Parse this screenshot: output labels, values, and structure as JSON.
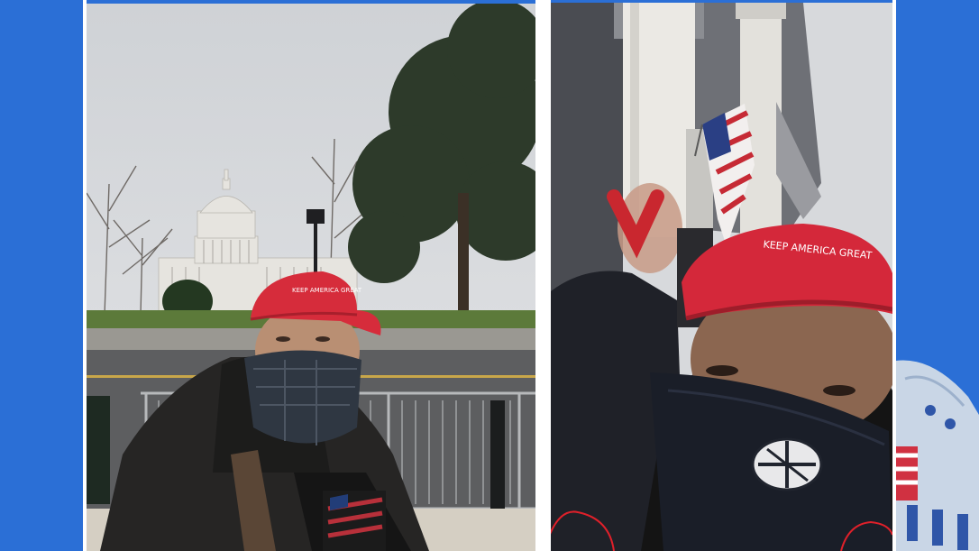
{
  "composite": {
    "background_color": "#2b6fd6",
    "layout": "two-photo side-by-side collage on blue background"
  },
  "left_photo": {
    "subject": "selfie in front of US Capitol dome",
    "cap_text": "KEEP AMERICA GREAT",
    "cap_color": "#d42a3a"
  },
  "right_photo": {
    "subject": "selfie under Capitol portico columns with US flag",
    "cap_text": "KEEP AMERICA GREAT",
    "cap_color": "#d42a3a",
    "annotation_color": "#e0202a"
  }
}
